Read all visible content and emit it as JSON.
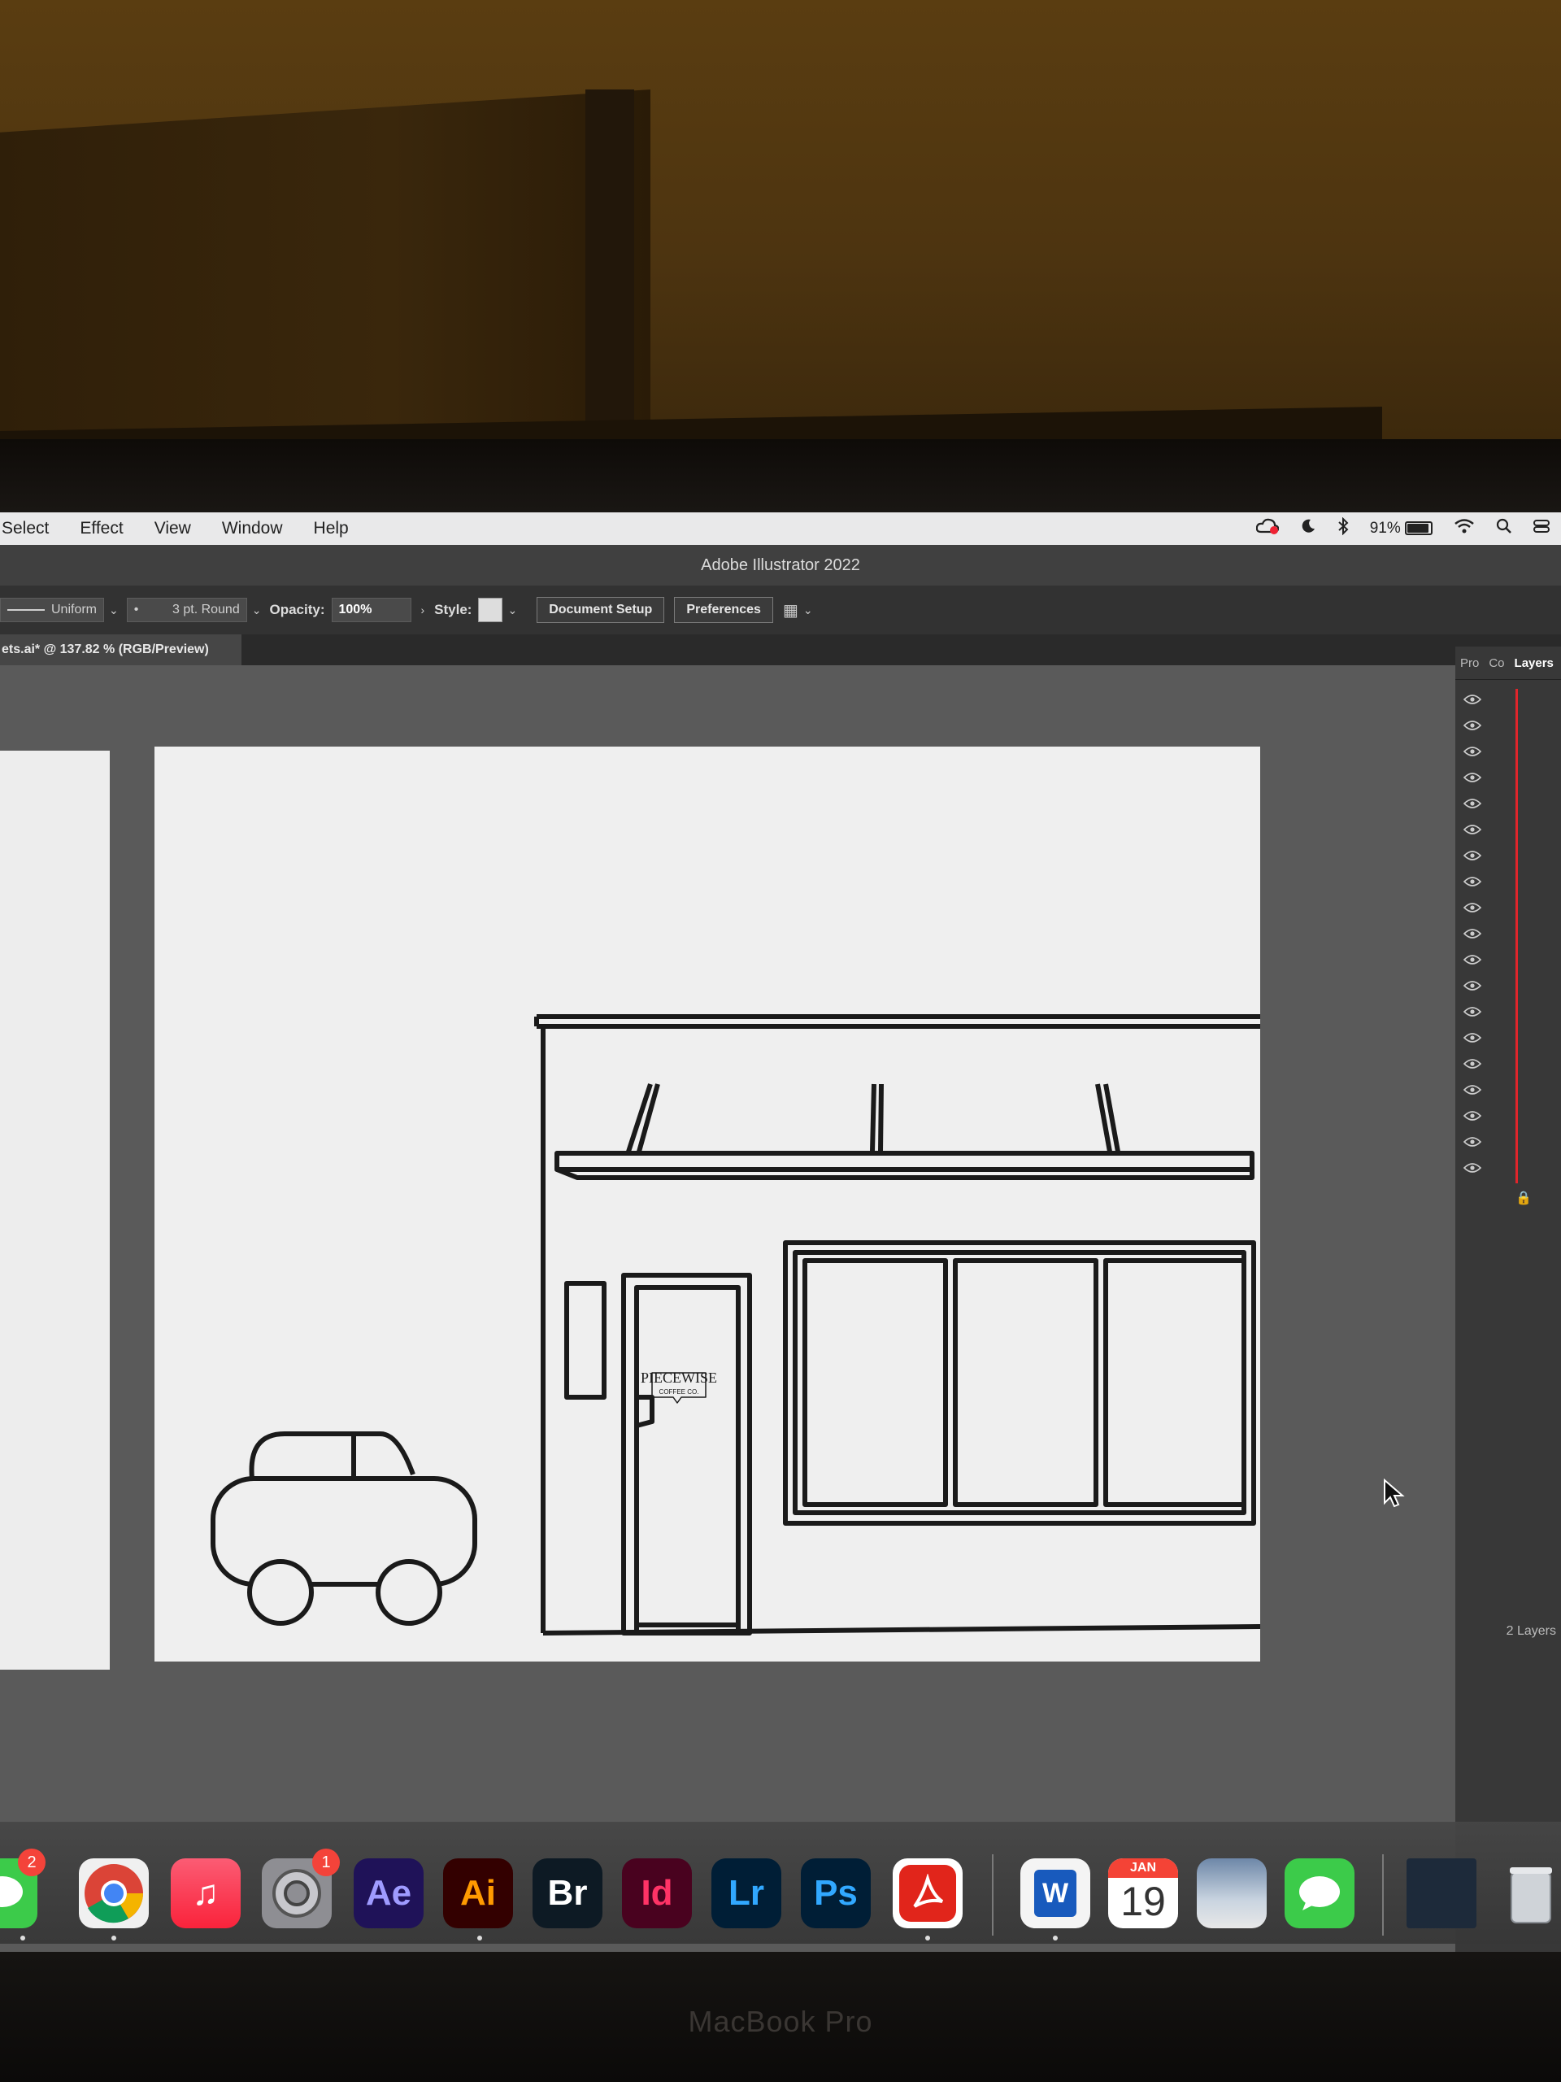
{
  "menubar": {
    "items": [
      "Select",
      "Effect",
      "View",
      "Window",
      "Help"
    ],
    "battery": "91%"
  },
  "window": {
    "title": "Adobe Illustrator 2022"
  },
  "control_bar": {
    "stroke_profile": "Uniform",
    "brush": "3 pt. Round",
    "opacity_label": "Opacity:",
    "opacity_value": "100%",
    "style_label": "Style:",
    "document_setup": "Document Setup",
    "preferences": "Preferences"
  },
  "document_tab": {
    "label": "ets.ai* @ 137.82 % (RGB/Preview)"
  },
  "artwork": {
    "sign_main": "PIECEWISE",
    "sign_sub": "COFFEE CO."
  },
  "panel": {
    "tabs": [
      "Pro",
      "Co",
      "Layers"
    ],
    "layer_color": "#e0252b",
    "layers_count": "2 Layers"
  },
  "dock": {
    "messages_badge": "2",
    "settings_badge": "1",
    "apps": [
      {
        "label": "Ae",
        "color": "#1f1258",
        "text_color": "#9f9bff"
      },
      {
        "label": "Ai",
        "color": "#330000",
        "text_color": "#ff9a00"
      },
      {
        "label": "Br",
        "color": "#0d1a24",
        "text_color": "#ffffff"
      },
      {
        "label": "Id",
        "color": "#49021f",
        "text_color": "#ff3366"
      },
      {
        "label": "Lr",
        "color": "#001e36",
        "text_color": "#31a8ff"
      },
      {
        "label": "Ps",
        "color": "#001e36",
        "text_color": "#31a8ff"
      }
    ],
    "calendar_month": "JAN",
    "calendar_day": "19",
    "word_label": "W"
  },
  "laptop": {
    "brand": "MacBook Pro"
  }
}
